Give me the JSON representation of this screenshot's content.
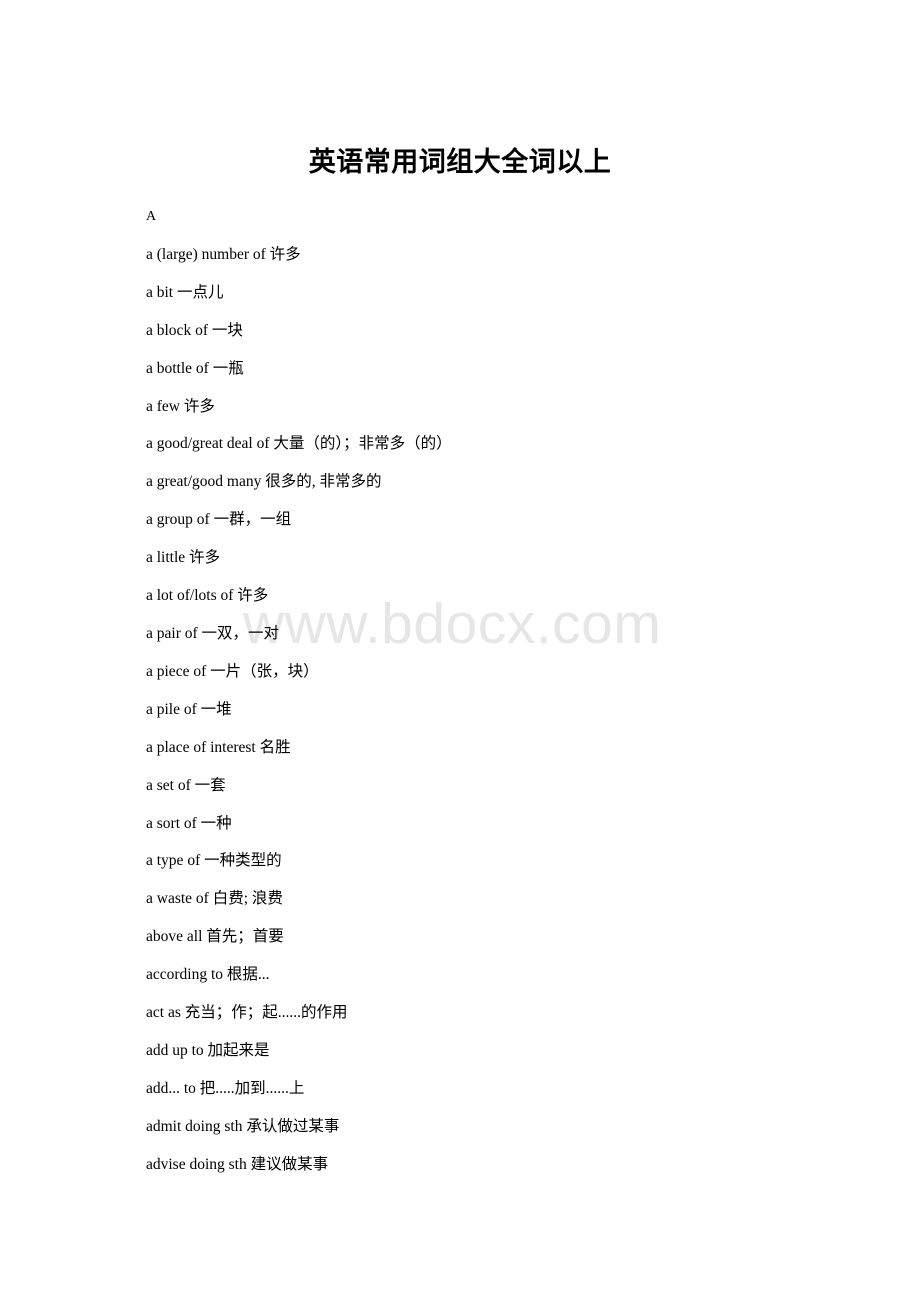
{
  "document": {
    "title": "英语常用词组大全词以上",
    "watermark": "www.bdocx.com",
    "watermark_color": "#e6e6e6",
    "section_letter": "A",
    "entries": [
      "a (large) number of 许多",
      "a bit 一点儿",
      "a block of 一块",
      "a bottle of 一瓶",
      "a few 许多",
      "a good/great deal of 大量（的）；非常多（的）",
      "a great/good many 很多的, 非常多的",
      "a group of 一群，一组",
      "a little 许多",
      "a lot of/lots of 许多",
      "a pair of 一双，一对",
      "a piece of 一片（张，块）",
      "a pile of 一堆",
      "a place of interest 名胜",
      "a set of 一套",
      "a sort of 一种",
      "a type of 一种类型的",
      "a waste of 白费; 浪费",
      "above all 首先；首要",
      "according to 根据...",
      "act as 充当；作；起......的作用",
      "add up to 加起来是",
      "add... to 把.....加到......上",
      "admit doing sth 承认做过某事",
      "advise doing sth 建议做某事"
    ]
  }
}
